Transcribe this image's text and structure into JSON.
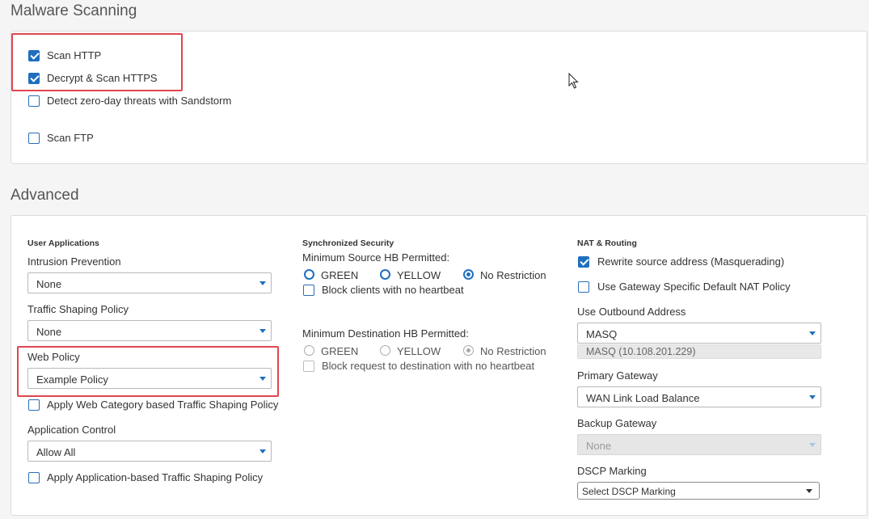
{
  "malware": {
    "title": "Malware Scanning",
    "items": [
      {
        "label": "Scan HTTP",
        "checked": true
      },
      {
        "label": "Decrypt & Scan HTTPS",
        "checked": true
      },
      {
        "label": "Detect zero-day threats with Sandstorm",
        "checked": false
      },
      {
        "label": "Scan FTP",
        "checked": false
      }
    ]
  },
  "advanced": {
    "title": "Advanced",
    "user_apps": {
      "heading": "User Applications",
      "intrusion_label": "Intrusion Prevention",
      "intrusion_value": "None",
      "traffic_label": "Traffic Shaping Policy",
      "traffic_value": "None",
      "web_policy_label": "Web Policy",
      "web_policy_value": "Example Policy",
      "web_category_check": "Apply Web Category based Traffic Shaping Policy",
      "app_control_label": "Application Control",
      "app_control_value": "Allow All",
      "app_traffic_check": "Apply Application-based Traffic Shaping Policy"
    },
    "sync_security": {
      "heading": "Synchronized Security",
      "min_source_label": "Minimum Source HB Permitted:",
      "green": "GREEN",
      "yellow": "YELLOW",
      "no_restriction": "No Restriction",
      "block_clients": "Block clients with no heartbeat",
      "min_dest_label": "Minimum Destination HB Permitted:",
      "block_request": "Block request to destination with no heartbeat"
    },
    "nat": {
      "heading": "NAT & Routing",
      "rewrite_label": "Rewrite source address (Masquerading)",
      "gateway_nat_label": "Use Gateway Specific Default NAT Policy",
      "outbound_label": "Use Outbound Address",
      "outbound_value": "MASQ",
      "outbound_detail": "MASQ (10.108.201.229)",
      "primary_label": "Primary Gateway",
      "primary_value": "WAN Link Load Balance",
      "backup_label": "Backup Gateway",
      "backup_value": "None",
      "dscp_label": "DSCP Marking",
      "dscp_value": "Select DSCP Marking"
    }
  },
  "colors": {
    "accent": "#1f6fbf",
    "highlight": "#e0464e"
  }
}
